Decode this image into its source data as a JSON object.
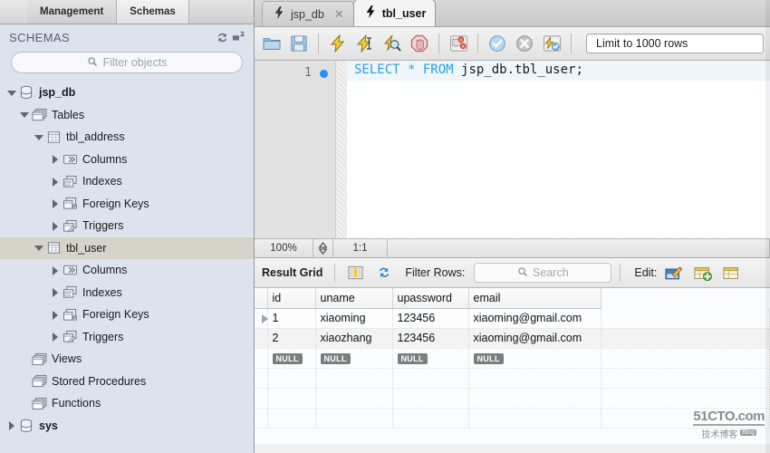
{
  "sidebar": {
    "tabs": [
      {
        "label": "Management",
        "active": false
      },
      {
        "label": "Schemas",
        "active": true
      }
    ],
    "panel_title": "SCHEMAS",
    "refresh_icon": "refresh-icon",
    "collapse_icon": "collapse-panel-icon",
    "filter": {
      "placeholder": "Filter objects",
      "value": "",
      "icon": "search-icon"
    },
    "tree": [
      {
        "label": "jsp_db",
        "depth": 0,
        "arrow": "down",
        "icon": "database-icon",
        "bold": true,
        "selected": false
      },
      {
        "label": "Tables",
        "depth": 1,
        "arrow": "down",
        "icon": "tables-folder-icon",
        "bold": false,
        "selected": false
      },
      {
        "label": "tbl_address",
        "depth": 2,
        "arrow": "down",
        "icon": "table-icon",
        "bold": false,
        "selected": false
      },
      {
        "label": "Columns",
        "depth": 3,
        "arrow": "right",
        "icon": "columns-icon",
        "bold": false,
        "selected": false
      },
      {
        "label": "Indexes",
        "depth": 3,
        "arrow": "right",
        "icon": "indexes-icon",
        "bold": false,
        "selected": false
      },
      {
        "label": "Foreign Keys",
        "depth": 3,
        "arrow": "right",
        "icon": "foreign-keys-icon",
        "bold": false,
        "selected": false
      },
      {
        "label": "Triggers",
        "depth": 3,
        "arrow": "right",
        "icon": "triggers-icon",
        "bold": false,
        "selected": false
      },
      {
        "label": "tbl_user",
        "depth": 2,
        "arrow": "down",
        "icon": "table-icon",
        "bold": false,
        "selected": true
      },
      {
        "label": "Columns",
        "depth": 3,
        "arrow": "right",
        "icon": "columns-icon",
        "bold": false,
        "selected": false
      },
      {
        "label": "Indexes",
        "depth": 3,
        "arrow": "right",
        "icon": "indexes-icon",
        "bold": false,
        "selected": false
      },
      {
        "label": "Foreign Keys",
        "depth": 3,
        "arrow": "right",
        "icon": "foreign-keys-icon",
        "bold": false,
        "selected": false
      },
      {
        "label": "Triggers",
        "depth": 3,
        "arrow": "right",
        "icon": "triggers-icon",
        "bold": false,
        "selected": false
      },
      {
        "label": "Views",
        "depth": 1,
        "arrow": "none",
        "icon": "views-icon",
        "bold": false,
        "selected": false
      },
      {
        "label": "Stored Procedures",
        "depth": 1,
        "arrow": "none",
        "icon": "stored-procedures-icon",
        "bold": false,
        "selected": false
      },
      {
        "label": "Functions",
        "depth": 1,
        "arrow": "none",
        "icon": "functions-icon",
        "bold": false,
        "selected": false
      },
      {
        "label": "sys",
        "depth": 0,
        "arrow": "right",
        "icon": "database-icon",
        "bold": true,
        "selected": false
      }
    ]
  },
  "editor_tabs": [
    {
      "label": "jsp_db",
      "icon": "sql-lightning-icon",
      "active": false,
      "closable": true,
      "close_glyph": "✕"
    },
    {
      "label": "tbl_user",
      "icon": "sql-lightning-icon",
      "active": true,
      "closable": false,
      "close_glyph": ""
    }
  ],
  "toolbar": {
    "buttons": [
      {
        "name": "open-sql-script-icon"
      },
      {
        "name": "save-sql-script-icon"
      },
      {
        "name": "separator"
      },
      {
        "name": "execute-statement-icon"
      },
      {
        "name": "execute-current-statement-icon"
      },
      {
        "name": "explain-statement-icon"
      },
      {
        "name": "stop-execution-icon"
      },
      {
        "name": "separator"
      },
      {
        "name": "toggle-stop-on-error-icon"
      },
      {
        "name": "separator"
      },
      {
        "name": "commit-transaction-icon"
      },
      {
        "name": "rollback-transaction-icon"
      },
      {
        "name": "toggle-autocommit-icon"
      },
      {
        "name": "separator"
      }
    ],
    "row_limit": "Limit to 1000 rows"
  },
  "code": {
    "line_number": "1",
    "keyword1": "SELECT",
    "star": " * ",
    "keyword2": "FROM",
    "identifier": " jsp_db.tbl_user;"
  },
  "editor_status": {
    "zoom": "100%",
    "stepper_icon": "stepper-up-down-icon",
    "cursor_position": "1:1"
  },
  "result_toolbar": {
    "title": "Result Grid",
    "grid_view_icon": "grid-view-icon",
    "refresh_icon": "refresh-results-icon",
    "filter_label": "Filter Rows:",
    "search": {
      "placeholder": "Search",
      "value": "",
      "icon": "search-icon"
    },
    "edit_label": "Edit:",
    "edit_icons": [
      "edit-row-icon",
      "insert-row-icon",
      "delete-row-icon"
    ]
  },
  "result_grid": {
    "columns": [
      "id",
      "uname",
      "upassword",
      "email",
      ""
    ],
    "rows": [
      {
        "current": true,
        "cells": [
          "1",
          "xiaoming",
          "123456",
          "xiaoming@gmail.com",
          ""
        ]
      },
      {
        "current": false,
        "cells": [
          "2",
          "xiaozhang",
          "123456",
          "xiaoming@gmail.com",
          ""
        ]
      }
    ],
    "null_row": {
      "label": "NULL",
      "count": 4
    },
    "empty_rows": 3
  },
  "watermark": {
    "line1": "51CTO.com",
    "line2": "技术博客",
    "sup": "Blog"
  },
  "colors": {
    "sidebar_bg": "#dce3ed",
    "selection": "#d6d3cb",
    "sql_keyword": "#2aa0e0",
    "breakpoint_dot": "#1e90ff",
    "null_badge": "#7d7d7d"
  }
}
